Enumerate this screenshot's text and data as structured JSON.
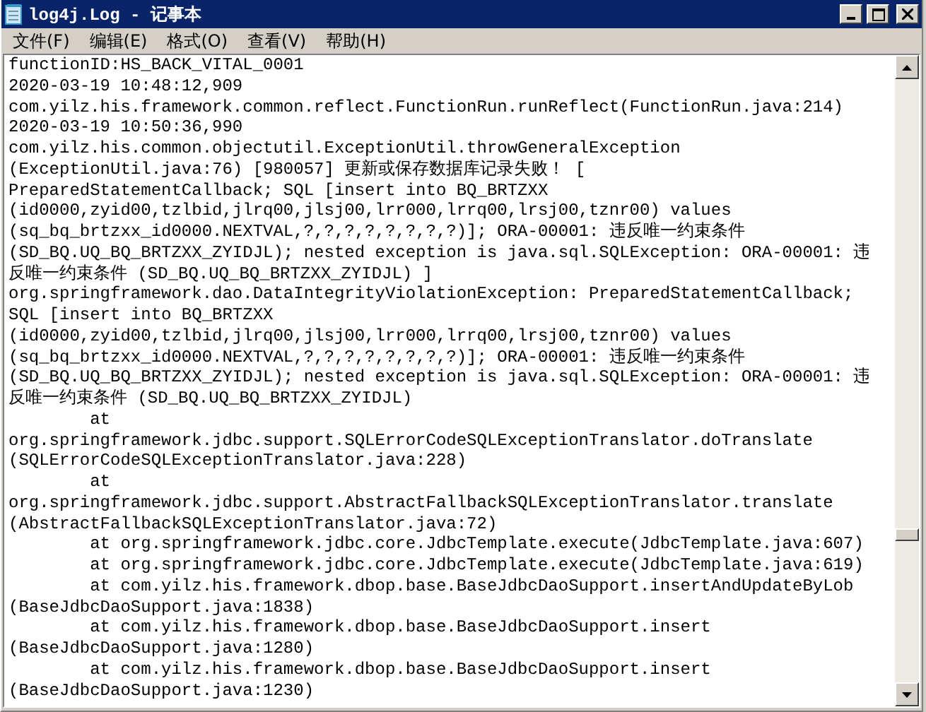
{
  "window": {
    "title": "log4j.Log - 记事本"
  },
  "menu": [
    {
      "label": "文件(F)"
    },
    {
      "label": "编辑(E)"
    },
    {
      "label": "格式(O)"
    },
    {
      "label": "查看(V)"
    },
    {
      "label": "帮助(H)"
    }
  ],
  "lines": [
    "functionID:HS_BACK_VITAL_0001",
    "2020-03-19 10:48:12,909",
    "com.yilz.his.framework.common.reflect.FunctionRun.runReflect(FunctionRun.java:214)",
    "2020-03-19 10:50:36,990",
    "com.yilz.his.common.objectutil.ExceptionUtil.throwGeneralException",
    "(ExceptionUtil.java:76) [980057] 更新或保存数据库记录失败！ [",
    "PreparedStatementCallback; SQL [insert into BQ_BRTZXX",
    "(id0000,zyid00,tzlbid,jlrq00,jlsj00,lrr000,lrrq00,lrsj00,tznr00) values",
    "(sq_bq_brtzxx_id0000.NEXTVAL,?,?,?,?,?,?,?,?)]; ORA-00001: 违反唯一约束条件",
    "(SD_BQ.UQ_BQ_BRTZXX_ZYIDJL); nested exception is java.sql.SQLException: ORA-00001: 违",
    "反唯一约束条件 (SD_BQ.UQ_BQ_BRTZXX_ZYIDJL) ]",
    "org.springframework.dao.DataIntegrityViolationException: PreparedStatementCallback;",
    "SQL [insert into BQ_BRTZXX",
    "(id0000,zyid00,tzlbid,jlrq00,jlsj00,lrr000,lrrq00,lrsj00,tznr00) values",
    "(sq_bq_brtzxx_id0000.NEXTVAL,?,?,?,?,?,?,?,?)]; ORA-00001: 违反唯一约束条件",
    "(SD_BQ.UQ_BQ_BRTZXX_ZYIDJL); nested exception is java.sql.SQLException: ORA-00001: 违",
    "反唯一约束条件 (SD_BQ.UQ_BQ_BRTZXX_ZYIDJL)",
    "\tat",
    "org.springframework.jdbc.support.SQLErrorCodeSQLExceptionTranslator.doTranslate",
    "(SQLErrorCodeSQLExceptionTranslator.java:228)",
    "\tat",
    "org.springframework.jdbc.support.AbstractFallbackSQLExceptionTranslator.translate",
    "(AbstractFallbackSQLExceptionTranslator.java:72)",
    "\tat org.springframework.jdbc.core.JdbcTemplate.execute(JdbcTemplate.java:607)",
    "\tat org.springframework.jdbc.core.JdbcTemplate.execute(JdbcTemplate.java:619)",
    "\tat com.yilz.his.framework.dbop.base.BaseJdbcDaoSupport.insertAndUpdateByLob",
    "(BaseJdbcDaoSupport.java:1838)",
    "\tat com.yilz.his.framework.dbop.base.BaseJdbcDaoSupport.insert",
    "(BaseJdbcDaoSupport.java:1280)",
    "\tat com.yilz.his.framework.dbop.base.BaseJdbcDaoSupport.insert",
    "(BaseJdbcDaoSupport.java:1230)"
  ]
}
